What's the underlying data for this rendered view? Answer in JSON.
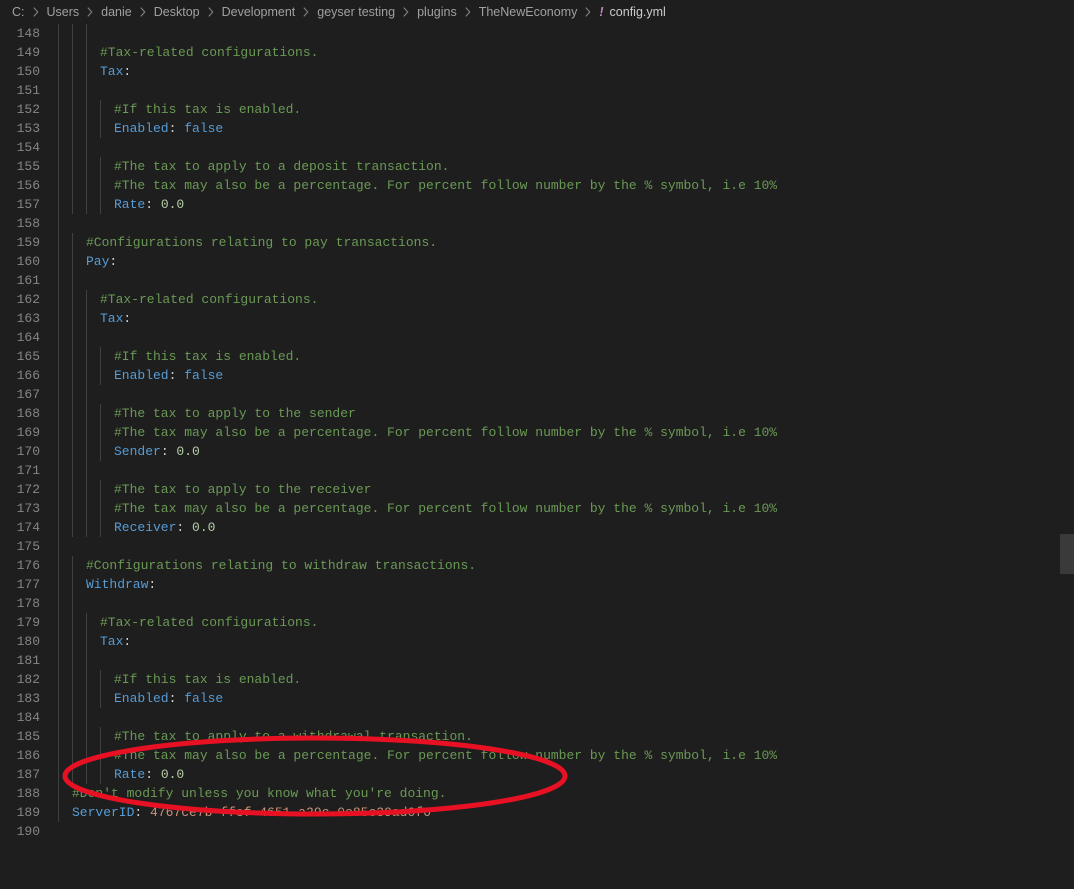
{
  "breadcrumb": {
    "segments": [
      "C:",
      "Users",
      "danie",
      "Desktop",
      "Development",
      "geyser testing",
      "plugins",
      "TheNewEconomy"
    ],
    "file_icon": "!",
    "filename": "config.yml"
  },
  "first_line_no": 148,
  "lines": [
    {
      "indent": 3,
      "tokens": []
    },
    {
      "indent": 3,
      "tokens": [
        [
          "comment",
          "#Tax-related configurations."
        ]
      ]
    },
    {
      "indent": 3,
      "tokens": [
        [
          "key",
          "Tax"
        ],
        [
          "sep",
          ":"
        ]
      ]
    },
    {
      "indent": 3,
      "tokens": []
    },
    {
      "indent": 4,
      "tokens": [
        [
          "comment",
          "#If this tax is enabled."
        ]
      ]
    },
    {
      "indent": 4,
      "tokens": [
        [
          "key",
          "Enabled"
        ],
        [
          "sep",
          ": "
        ],
        [
          "bool",
          "false"
        ]
      ]
    },
    {
      "indent": 3,
      "tokens": []
    },
    {
      "indent": 4,
      "tokens": [
        [
          "comment",
          "#The tax to apply to a deposit transaction."
        ]
      ]
    },
    {
      "indent": 4,
      "tokens": [
        [
          "comment",
          "#The tax may also be a percentage. For percent follow number by the % symbol, i.e 10%"
        ]
      ]
    },
    {
      "indent": 4,
      "tokens": [
        [
          "key",
          "Rate"
        ],
        [
          "sep",
          ": "
        ],
        [
          "num",
          "0.0"
        ]
      ]
    },
    {
      "indent": 1,
      "tokens": []
    },
    {
      "indent": 2,
      "tokens": [
        [
          "comment",
          "#Configurations relating to pay transactions."
        ]
      ]
    },
    {
      "indent": 2,
      "tokens": [
        [
          "key",
          "Pay"
        ],
        [
          "sep",
          ":"
        ]
      ]
    },
    {
      "indent": 2,
      "tokens": []
    },
    {
      "indent": 3,
      "tokens": [
        [
          "comment",
          "#Tax-related configurations."
        ]
      ]
    },
    {
      "indent": 3,
      "tokens": [
        [
          "key",
          "Tax"
        ],
        [
          "sep",
          ":"
        ]
      ]
    },
    {
      "indent": 3,
      "tokens": []
    },
    {
      "indent": 4,
      "tokens": [
        [
          "comment",
          "#If this tax is enabled."
        ]
      ]
    },
    {
      "indent": 4,
      "tokens": [
        [
          "key",
          "Enabled"
        ],
        [
          "sep",
          ": "
        ],
        [
          "bool",
          "false"
        ]
      ]
    },
    {
      "indent": 3,
      "tokens": []
    },
    {
      "indent": 4,
      "tokens": [
        [
          "comment",
          "#The tax to apply to the sender"
        ]
      ]
    },
    {
      "indent": 4,
      "tokens": [
        [
          "comment",
          "#The tax may also be a percentage. For percent follow number by the % symbol, i.e 10%"
        ]
      ]
    },
    {
      "indent": 4,
      "tokens": [
        [
          "key",
          "Sender"
        ],
        [
          "sep",
          ": "
        ],
        [
          "num",
          "0.0"
        ]
      ]
    },
    {
      "indent": 3,
      "tokens": []
    },
    {
      "indent": 4,
      "tokens": [
        [
          "comment",
          "#The tax to apply to the receiver"
        ]
      ]
    },
    {
      "indent": 4,
      "tokens": [
        [
          "comment",
          "#The tax may also be a percentage. For percent follow number by the % symbol, i.e 10%"
        ]
      ]
    },
    {
      "indent": 4,
      "tokens": [
        [
          "key",
          "Receiver"
        ],
        [
          "sep",
          ": "
        ],
        [
          "num",
          "0.0"
        ]
      ]
    },
    {
      "indent": 1,
      "tokens": []
    },
    {
      "indent": 2,
      "tokens": [
        [
          "comment",
          "#Configurations relating to withdraw transactions."
        ]
      ]
    },
    {
      "indent": 2,
      "tokens": [
        [
          "key",
          "Withdraw"
        ],
        [
          "sep",
          ":"
        ]
      ]
    },
    {
      "indent": 2,
      "tokens": []
    },
    {
      "indent": 3,
      "tokens": [
        [
          "comment",
          "#Tax-related configurations."
        ]
      ]
    },
    {
      "indent": 3,
      "tokens": [
        [
          "key",
          "Tax"
        ],
        [
          "sep",
          ":"
        ]
      ]
    },
    {
      "indent": 3,
      "tokens": []
    },
    {
      "indent": 4,
      "tokens": [
        [
          "comment",
          "#If this tax is enabled."
        ]
      ]
    },
    {
      "indent": 4,
      "tokens": [
        [
          "key",
          "Enabled"
        ],
        [
          "sep",
          ": "
        ],
        [
          "bool",
          "false"
        ]
      ]
    },
    {
      "indent": 3,
      "tokens": []
    },
    {
      "indent": 4,
      "tokens": [
        [
          "comment",
          "#The tax to apply to a withdrawal transaction."
        ]
      ]
    },
    {
      "indent": 4,
      "tokens": [
        [
          "comment",
          "#The tax may also be a percentage. For percent follow number by the % symbol, i.e 10%"
        ]
      ]
    },
    {
      "indent": 4,
      "tokens": [
        [
          "key",
          "Rate"
        ],
        [
          "sep",
          ": "
        ],
        [
          "num",
          "0.0"
        ]
      ]
    },
    {
      "indent": 1,
      "tokens": [
        [
          "comment",
          "#Don't modify unless you know what you're doing."
        ]
      ]
    },
    {
      "indent": 1,
      "tokens": [
        [
          "key",
          "ServerID"
        ],
        [
          "sep",
          ": "
        ],
        [
          "str",
          "4767ce7b-ffef-4651-a29c-0e85c39ad0f6"
        ]
      ]
    },
    {
      "indent": 0,
      "tokens": []
    }
  ]
}
